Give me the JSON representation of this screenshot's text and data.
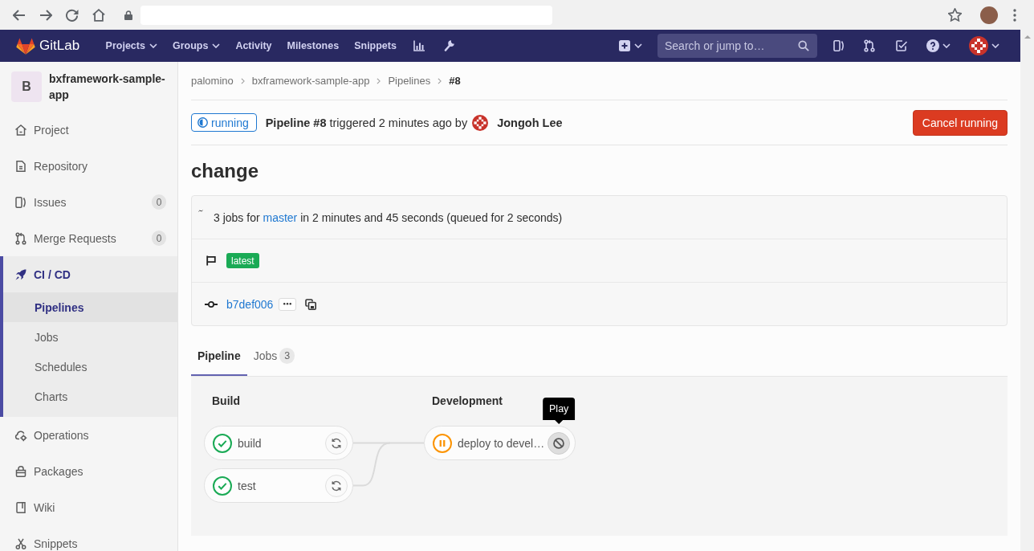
{
  "navbar": {
    "brand": "GitLab",
    "items": [
      {
        "label": "Projects",
        "dropdown": true
      },
      {
        "label": "Groups",
        "dropdown": true
      },
      {
        "label": "Activity",
        "dropdown": false
      },
      {
        "label": "Milestones",
        "dropdown": false
      },
      {
        "label": "Snippets",
        "dropdown": false
      }
    ],
    "search": {
      "placeholder": "Search or jump to…"
    }
  },
  "sidebar": {
    "project": {
      "initial": "B",
      "name": "bxframework-sample-app"
    },
    "items": [
      {
        "label": "Project",
        "selected": false
      },
      {
        "label": "Repository",
        "selected": false
      },
      {
        "label": "Issues",
        "count": "0",
        "selected": false
      },
      {
        "label": "Merge Requests",
        "count": "0",
        "selected": false
      },
      {
        "label": "CI / CD",
        "selected": true,
        "children": [
          {
            "label": "Pipelines",
            "selected": true
          },
          {
            "label": "Jobs",
            "selected": false
          },
          {
            "label": "Schedules",
            "selected": false
          },
          {
            "label": "Charts",
            "selected": false
          }
        ]
      },
      {
        "label": "Operations",
        "selected": false
      },
      {
        "label": "Packages",
        "selected": false
      },
      {
        "label": "Wiki",
        "selected": false
      },
      {
        "label": "Snippets",
        "selected": false
      }
    ]
  },
  "breadcrumbs": [
    "palomino",
    "bxframework-sample-app",
    "Pipelines",
    "#8"
  ],
  "header": {
    "status": {
      "kind": "running",
      "label": "running"
    },
    "text": "**Pipeline #8** triggered 2 minutes ago by",
    "author": "Jongoh Lee",
    "action": "Cancel running"
  },
  "title": "change",
  "info": {
    "summary": {
      "prefix": "3 jobs for",
      "ref": "master",
      "suffix": "in 2 minutes and 45 seconds (queued for 2 seconds)"
    },
    "badges": [
      "latest"
    ],
    "commit": "b7def006"
  },
  "tabs": [
    {
      "label": "Pipeline",
      "selected": true
    },
    {
      "label": "Jobs",
      "count": "3",
      "selected": false
    }
  ],
  "graph": {
    "stages": [
      {
        "title": "Build",
        "jobs": [
          {
            "name": "build",
            "status": {
              "kind": "success"
            },
            "action": {
              "kind": "retry",
              "hovered": false
            }
          },
          {
            "name": "test",
            "status": {
              "kind": "success"
            },
            "action": {
              "kind": "retry",
              "hovered": false
            }
          }
        ]
      },
      {
        "title": "Development",
        "jobs": [
          {
            "name": "deploy to devel…",
            "status": {
              "kind": "paused"
            },
            "action": {
              "kind": "play",
              "hovered": true,
              "tooltip": "Play"
            }
          }
        ]
      }
    ]
  }
}
